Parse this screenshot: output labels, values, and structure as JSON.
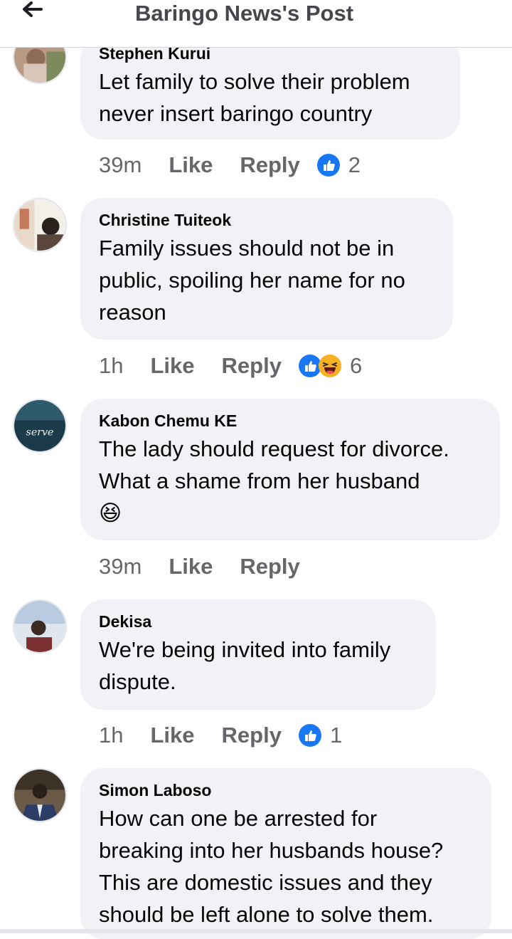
{
  "header": {
    "title": "Baringo News's Post"
  },
  "comments": [
    {
      "author": "Stephen Kurui",
      "text": [
        "Let family to solve their problem",
        "never insert baringo country"
      ],
      "time": "39m",
      "like": "Like",
      "reply": "Reply",
      "reactions": [
        "like-icon"
      ],
      "count": "2"
    },
    {
      "author": "Christine Tuiteok",
      "text": [
        "Family issues should not be in",
        "public, spoiling her name for no",
        "reason"
      ],
      "time": "1h",
      "like": "Like",
      "reply": "Reply",
      "reactions": [
        "like-icon",
        "haha-icon"
      ],
      "count": "6"
    },
    {
      "author": "Kabon Chemu KE",
      "text": [
        "The lady should request for divorce.",
        "What a shame from her husband",
        "😆"
      ],
      "time": "39m",
      "like": "Like",
      "reply": "Reply"
    },
    {
      "author": "Dekisa",
      "text": [
        "We're being invited into family",
        "dispute."
      ],
      "time": "1h",
      "like": "Like",
      "reply": "Reply",
      "reactions": [
        "like-icon"
      ],
      "count": "1"
    },
    {
      "author": "Simon Laboso",
      "text": [
        "How can one be arrested for",
        "breaking into her husbands house?",
        "This are domestic issues and they",
        "should be left alone to solve them."
      ]
    }
  ],
  "avatar_texts": {
    "kabon_badge": "serve"
  },
  "colors": {
    "like_blue": "#1877f2",
    "haha_yellow": "#f7b125",
    "bubble": "#f0f2f5",
    "meta_gray": "#65676b"
  }
}
